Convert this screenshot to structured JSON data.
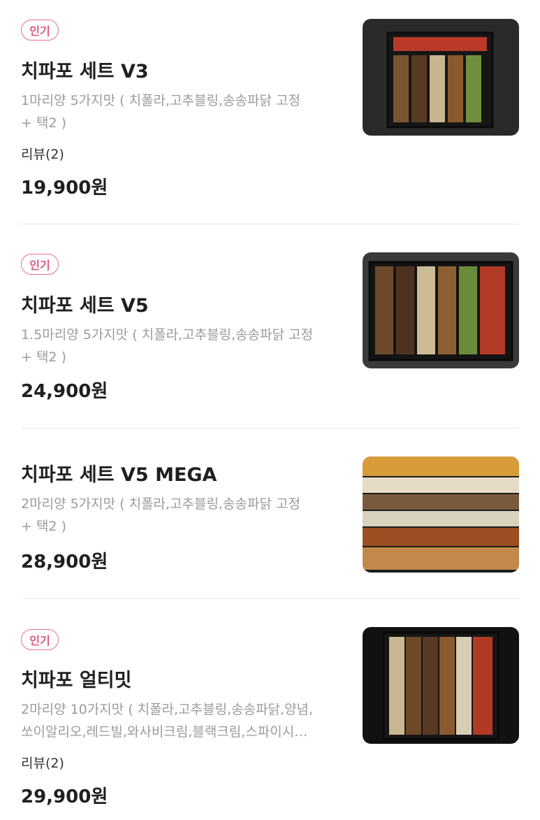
{
  "menu_items": [
    {
      "badge": "인기",
      "title": "치파포 세트 V3",
      "desc_line1": "1마리양 5가지맛 ( 치폴라,고추블링,송송파닭 고정",
      "desc_line2": "+ 택2 )",
      "review": "리뷰(2)",
      "price": "19,900원"
    },
    {
      "badge": "인기",
      "title": "치파포 세트 V5",
      "desc_line1": "1.5마리양 5가지맛 ( 치폴라,고추블링,송송파닭 고정",
      "desc_line2": "+ 택2 )",
      "price": "24,900원"
    },
    {
      "title": "치파포 세트 V5 MEGA",
      "desc_line1": "2마리양 5가지맛 ( 치폴라,고추블링,송송파닭 고정",
      "desc_line2": "+ 택2 )",
      "price": "28,900원"
    },
    {
      "badge": "인기",
      "title": "치파포 얼티밋",
      "desc_line1": "2마리양 10가지맛 ( 치폴라,고추블링,송송파닭,양념,",
      "desc_line2": "쏘이알리오,레드빌,와사비크림,블랙크림,스파이시…",
      "review": "리뷰(2)",
      "price": "29,900원"
    }
  ]
}
